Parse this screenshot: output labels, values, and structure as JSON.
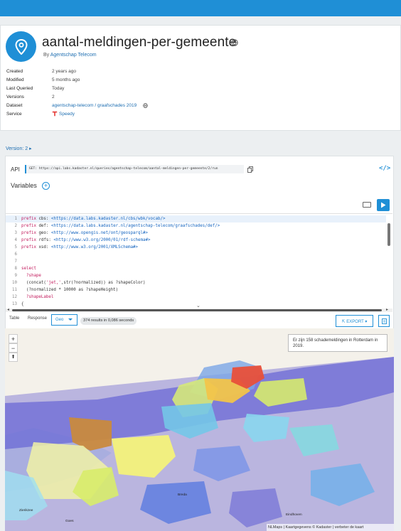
{
  "header": {
    "title": "aantal-meldingen-per-gemeente",
    "by_prefix": "By",
    "author": "Agentschap Telecom"
  },
  "meta": {
    "created_label": "Created",
    "created_value": "2 years ago",
    "modified_label": "Modified",
    "modified_value": "5 months ago",
    "last_queried_label": "Last Queried",
    "last_queried_value": "Today",
    "versions_label": "Versions",
    "versions_value": "2",
    "dataset_label": "Dataset",
    "dataset_value": "agentschap-telecom / graafschades 2019",
    "service_label": "Service",
    "service_value": "Speedy"
  },
  "version_selector": "Version: 2",
  "api": {
    "label": "API",
    "url": "GET: https://api.labs.kadaster.nl/queries/agentschap-telecom/aantal-meldingen-per-gemeente/2/run"
  },
  "variables_label": "Variables",
  "variables_add": "+",
  "code_lines": [
    {
      "n": "1",
      "parts": [
        [
          "kw",
          "prefix "
        ],
        [
          "tx",
          "cbs: "
        ],
        [
          "iri",
          "<https://data.labs.kadaster.nl/cbs/wbk/vocab/>"
        ]
      ]
    },
    {
      "n": "2",
      "parts": [
        [
          "kw",
          "prefix "
        ],
        [
          "tx",
          "def: "
        ],
        [
          "iri",
          "<https://data.labs.kadaster.nl/agentschap-telecom/graafschades/def/>"
        ]
      ]
    },
    {
      "n": "3",
      "parts": [
        [
          "kw",
          "prefix "
        ],
        [
          "tx",
          "geo: "
        ],
        [
          "iri",
          "<http://www.opengis.net/ont/geosparql#>"
        ]
      ]
    },
    {
      "n": "4",
      "parts": [
        [
          "kw",
          "prefix "
        ],
        [
          "tx",
          "rdfs: "
        ],
        [
          "iri",
          "<http://www.w3.org/2000/01/rdf-schema#>"
        ]
      ]
    },
    {
      "n": "5",
      "parts": [
        [
          "kw",
          "prefix "
        ],
        [
          "tx",
          "xsd: "
        ],
        [
          "iri",
          "<http://www.w3.org/2001/XMLSchema#>"
        ]
      ]
    },
    {
      "n": "6",
      "parts": []
    },
    {
      "n": "7",
      "parts": []
    },
    {
      "n": "8",
      "parts": [
        [
          "kw",
          "select"
        ]
      ]
    },
    {
      "n": "9",
      "parts": [
        [
          "tx",
          "  "
        ],
        [
          "kw",
          "?shape"
        ]
      ]
    },
    {
      "n": "10",
      "parts": [
        [
          "tx",
          "  (concat("
        ],
        [
          "kw",
          "'jet,'"
        ],
        [
          "tx",
          ",str(?normalized)) as ?shapeColor)"
        ]
      ]
    },
    {
      "n": "11",
      "parts": [
        [
          "tx",
          "  (?normalized * 10000 as ?shapeHeight)"
        ]
      ]
    },
    {
      "n": "12",
      "parts": [
        [
          "tx",
          "  "
        ],
        [
          "kw",
          "?shapeLabel"
        ]
      ]
    },
    {
      "n": "13",
      "parts": [
        [
          "tx",
          "{"
        ]
      ]
    },
    {
      "n": "14",
      "parts": [
        [
          "tx",
          "  {"
        ]
      ]
    }
  ],
  "results_tabs": {
    "table": "Table",
    "response": "Response",
    "geo": "Geo"
  },
  "results_count": "374 results in 0,086 seconds",
  "export_label": "EXPORT",
  "map": {
    "zoom_in": "+",
    "zoom_out": "−",
    "reset": "⬆",
    "popup_text": "Er zijn 158 schademeldingen in Rotterdam in 2019.",
    "attribution": "NLMaps | Kaartgegevens © Kadaster | verbeter de kaart",
    "city_labels": [
      "Zierikzee",
      "Goes",
      "Breda",
      "Eindhoven"
    ]
  },
  "colors": {
    "brand": "#1f8fd6",
    "link": "#1f6fb2"
  }
}
